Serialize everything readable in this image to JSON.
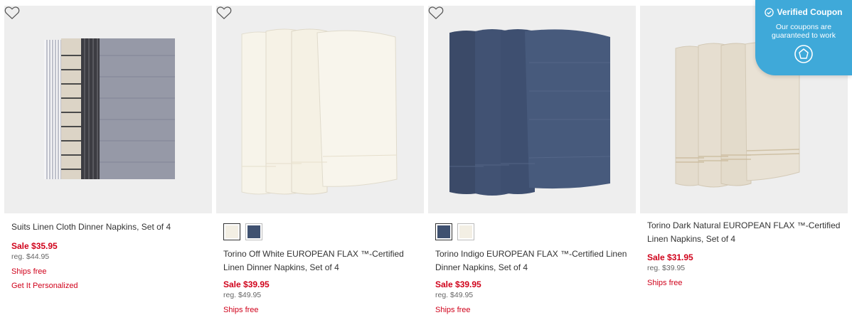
{
  "products": [
    {
      "title": "Suits Linen Cloth Dinner Napkins, Set of 4",
      "sale": "Sale $35.95",
      "reg": "reg. $44.95",
      "shipping": "Ships free",
      "personalize": "Get It Personalized"
    },
    {
      "title": "Torino Off White EUROPEAN FLAX ™-Certified Linen Dinner Napkins, Set of 4",
      "sale": "Sale $39.95",
      "reg": "reg. $49.95",
      "shipping": "Ships free",
      "swatch_colors": [
        "#f3efe4",
        "#3f5170"
      ]
    },
    {
      "title": "Torino Indigo EUROPEAN FLAX ™-Certified Linen Dinner Napkins, Set of 4",
      "sale": "Sale $39.95",
      "reg": "reg. $49.95",
      "shipping": "Ships free",
      "swatch_colors": [
        "#3f5170",
        "#f3efe4"
      ]
    },
    {
      "title": "Torino Dark Natural EUROPEAN FLAX ™-Certified Linen Napkins, Set of 4",
      "sale": "Sale $31.95",
      "reg": "reg. $39.95",
      "shipping": "Ships free"
    }
  ],
  "coupon": {
    "title": "Verified Coupon",
    "subtitle": "Our coupons are guaranteed to work",
    "background": "#3fa9d9"
  },
  "colors": {
    "sale": "#d0021b",
    "image_bg": "#eeeeee"
  },
  "icons": {
    "favorite": "heart-icon",
    "coupon_check": "check-circle-icon",
    "coupon_logo": "tag-icon"
  }
}
